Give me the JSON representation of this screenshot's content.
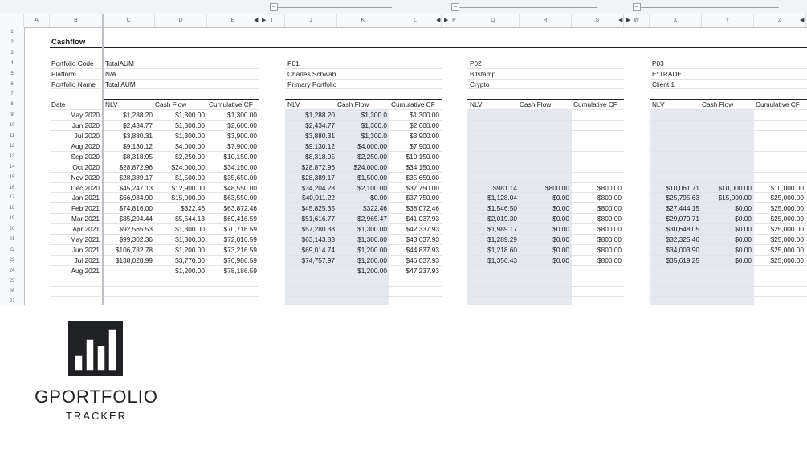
{
  "columns": [
    "A",
    "B",
    "C",
    "D",
    "E",
    "I",
    "J",
    "K",
    "L",
    "P",
    "Q",
    "R",
    "S",
    "W",
    "X",
    "Y",
    "Z"
  ],
  "rows": [
    "1",
    "2",
    "3",
    "4",
    "5",
    "6",
    "7",
    "8",
    "9",
    "10",
    "11",
    "12",
    "13",
    "14",
    "15",
    "16",
    "17",
    "18",
    "19",
    "20",
    "21",
    "22",
    "23",
    "24",
    "25",
    "26",
    "27"
  ],
  "sheet_title": "Cashflow",
  "info_labels": [
    "Portfolio Code",
    "Platform",
    "Portfolio Name"
  ],
  "portfolios": [
    {
      "code": "TotalAUM",
      "platform": "N/A",
      "name": "Total AUM"
    },
    {
      "code": "P01",
      "platform": "Charles Schwab",
      "name": "Primary Portfolio"
    },
    {
      "code": "P02",
      "platform": "Bitstamp",
      "name": "Crypto"
    },
    {
      "code": "P03",
      "platform": "E*TRADE",
      "name": "Client 1"
    }
  ],
  "headers": {
    "date": "Date",
    "nlv": "NLV",
    "cash_flow": "Cash Flow",
    "cumulative": "Cumulative CF"
  },
  "dates": [
    "May 2020",
    "Jun 2020",
    "Jul 2020",
    "Aug 2020",
    "Sep 2020",
    "Oct 2020",
    "Nov 2020",
    "Dec 2020",
    "Jan 2021",
    "Feb 2021",
    "Mar 2021",
    "Apr 2021",
    "May 2021",
    "Jun 2021",
    "Jul 2021",
    "Aug 2021"
  ],
  "tables": [
    {
      "nlv": [
        "$1,288.20",
        "$2,434.77",
        "$3,880.31",
        "$9,130.12",
        "$8,318.95",
        "$28,872.96",
        "$28,389.17",
        "$45,247.13",
        "$66,934.90",
        "$74,816.00",
        "$85,294.44",
        "$92,565.53",
        "$99,302.36",
        "$106,782.78",
        "$138,028.99",
        ""
      ],
      "cf": [
        "$1,300.00",
        "$1,300.00",
        "$1,300.00",
        "$4,000.00",
        "$2,250.00",
        "$24,000.00",
        "$1,500.00",
        "$12,900.00",
        "$15,000.00",
        "$322.46",
        "$5,544.13",
        "$1,300.00",
        "$1,300.00",
        "$1,200.00",
        "$3,770.00",
        "$1,200.00"
      ],
      "cum": [
        "$1,300.00",
        "$2,600.00",
        "$3,900.00",
        "$7,900.00",
        "$10,150.00",
        "$34,150.00",
        "$35,650.00",
        "$48,550.00",
        "$63,550.00",
        "$63,872.46",
        "$69,416.59",
        "$70,716.59",
        "$72,016.59",
        "$73,216.59",
        "$76,986.59",
        "$78,186.59"
      ]
    },
    {
      "nlv": [
        "$1,288.20",
        "$2,434.77",
        "$3,880.31",
        "$9,130.12",
        "$8,318.95",
        "$28,872.96",
        "$28,389.17",
        "$34,204.28",
        "$40,011.22",
        "$45,825.35",
        "$51,616.77",
        "$57,280.38",
        "$63,143.83",
        "$69,014.74",
        "$74,757.97",
        ""
      ],
      "cf": [
        "$1,300.0",
        "$1,300.0",
        "$1,300.0",
        "$4,000.00",
        "$2,250.00",
        "$24,000.00",
        "$1,500.00",
        "$2,100.00",
        "$0.00",
        "$322.46",
        "$2,965.47",
        "$1,300.00",
        "$1,300.00",
        "$1,200.00",
        "$1,200.00",
        "$1,200.00"
      ],
      "cum": [
        "$1,300.00",
        "$2,600.00",
        "$3,900.00",
        "$7,900.00",
        "$10,150.00",
        "$34,150.00",
        "$35,650.00",
        "$37,750.00",
        "$37,750.00",
        "$38,072.46",
        "$41,037.93",
        "$42,337.93",
        "$43,637.93",
        "$44,837.93",
        "$46,037.93",
        "$47,237.93"
      ]
    },
    {
      "nlv": [
        "",
        "",
        "",
        "",
        "",
        "",
        "",
        "$981.14",
        "$1,128.04",
        "$1,546.50",
        "$2,019.30",
        "$1,989.17",
        "$1,289.29",
        "$1,218.60",
        "$1,356.43",
        ""
      ],
      "cf": [
        "",
        "",
        "",
        "",
        "",
        "",
        "",
        "$800.00",
        "$0.00",
        "$0.00",
        "$0.00",
        "$0.00",
        "$0.00",
        "$0.00",
        "$0.00",
        ""
      ],
      "cum": [
        "",
        "",
        "",
        "",
        "",
        "",
        "",
        "$800.00",
        "$800.00",
        "$800.00",
        "$800.00",
        "$800.00",
        "$800.00",
        "$800.00",
        "$800.00",
        ""
      ]
    },
    {
      "nlv": [
        "",
        "",
        "",
        "",
        "",
        "",
        "",
        "$10,061.71",
        "$25,795.63",
        "$27,444.15",
        "$29,079.71",
        "$30,648.05",
        "$32,325.46",
        "$34,003.90",
        "$35,619.25",
        ""
      ],
      "cf": [
        "",
        "",
        "",
        "",
        "",
        "",
        "",
        "$10,000.00",
        "$15,000.00",
        "$0.00",
        "$0.00",
        "$0.00",
        "$0.00",
        "$0.00",
        "$0.00",
        ""
      ],
      "cum": [
        "",
        "",
        "",
        "",
        "",
        "",
        "",
        "$10,000.00",
        "$25,000.00",
        "$25,000.00",
        "$25,000.00",
        "$25,000.00",
        "$25,000.00",
        "$25,000.00",
        "$25,000.00",
        ""
      ]
    }
  ],
  "logo": {
    "name": "GPORTFOLIO",
    "subtitle": "TRACKER",
    "icon": "bar-chart-logo-icon"
  },
  "colors": {
    "shade": "#e3e9ef",
    "header_bg": "#f8f9fa",
    "text": "#202124"
  }
}
